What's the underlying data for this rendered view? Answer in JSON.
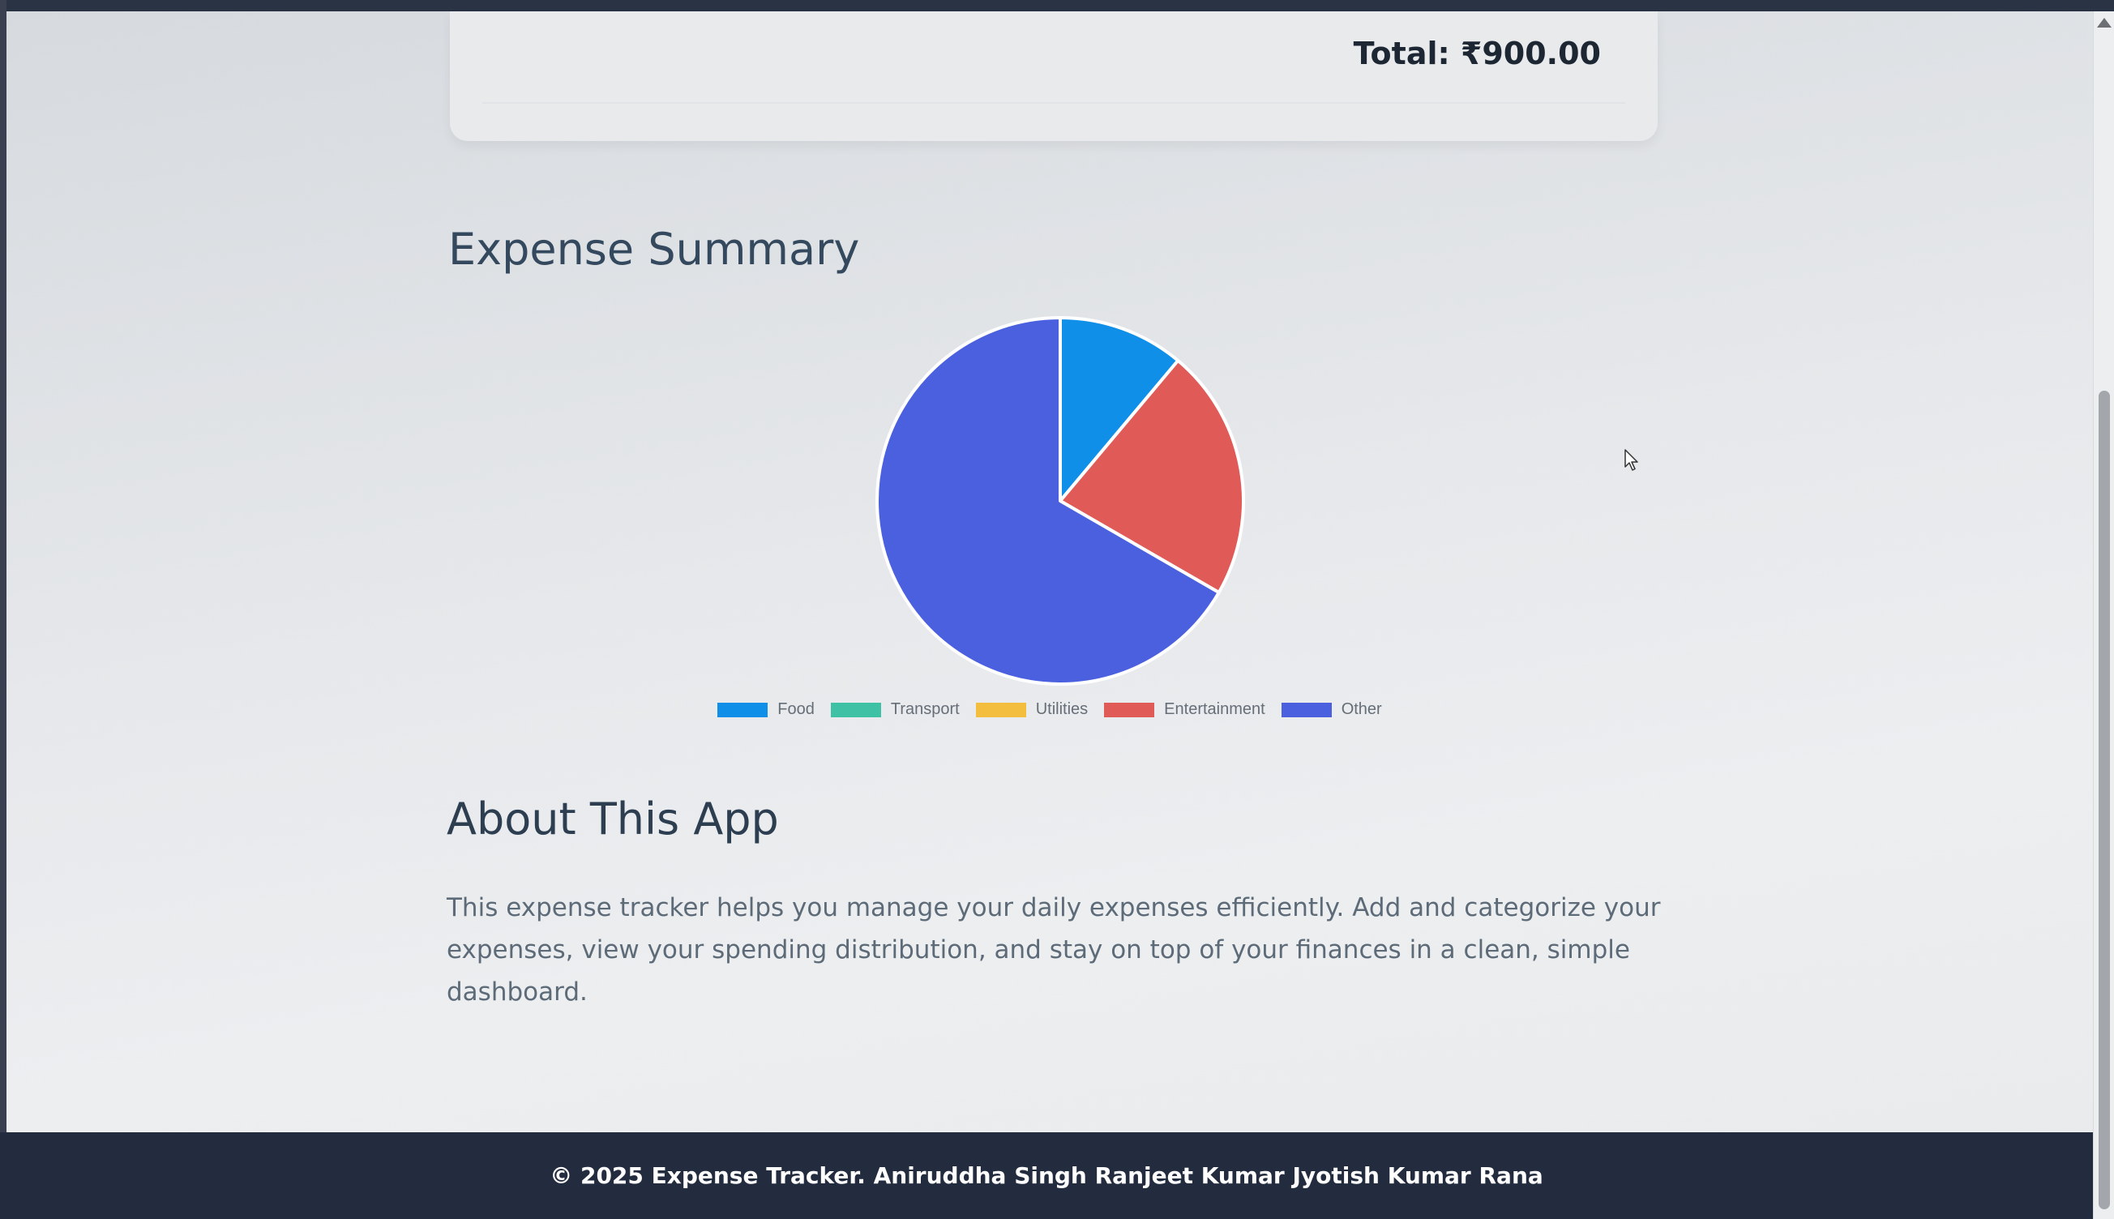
{
  "totals": {
    "total_label": "Total: ₹900.00"
  },
  "summary": {
    "title": "Expense Summary"
  },
  "chart_data": {
    "type": "pie",
    "title": "",
    "start": "top, clockwise",
    "labels": [
      "Food",
      "Transport",
      "Utilities",
      "Entertainment",
      "Other"
    ],
    "values": [
      100,
      0,
      0,
      200,
      600
    ],
    "colors": [
      "#0f8fe8",
      "#3fc1a6",
      "#f3bd3e",
      "#e05a58",
      "#4a60df"
    ],
    "legend": {
      "position": "bottom",
      "entries": [
        {
          "label": "Food",
          "color": "#0f8fe8"
        },
        {
          "label": "Transport",
          "color": "#3fc1a6"
        },
        {
          "label": "Utilities",
          "color": "#f3bd3e"
        },
        {
          "label": "Entertainment",
          "color": "#e05a58"
        },
        {
          "label": "Other",
          "color": "#4a60df"
        }
      ]
    }
  },
  "about": {
    "title": "About This App",
    "text": "This expense tracker helps you manage your daily expenses efficiently. Add and categorize your expenses, view your spending distribution, and stay on top of your finances in a clean, simple dashboard."
  },
  "footer": {
    "text": "© 2025 Expense Tracker. Aniruddha Singh Ranjeet Kumar Jyotish Kumar Rana"
  },
  "icons": {
    "cursor": "arrow-pointer-icon",
    "scroll_up": "triangle-up-icon"
  }
}
